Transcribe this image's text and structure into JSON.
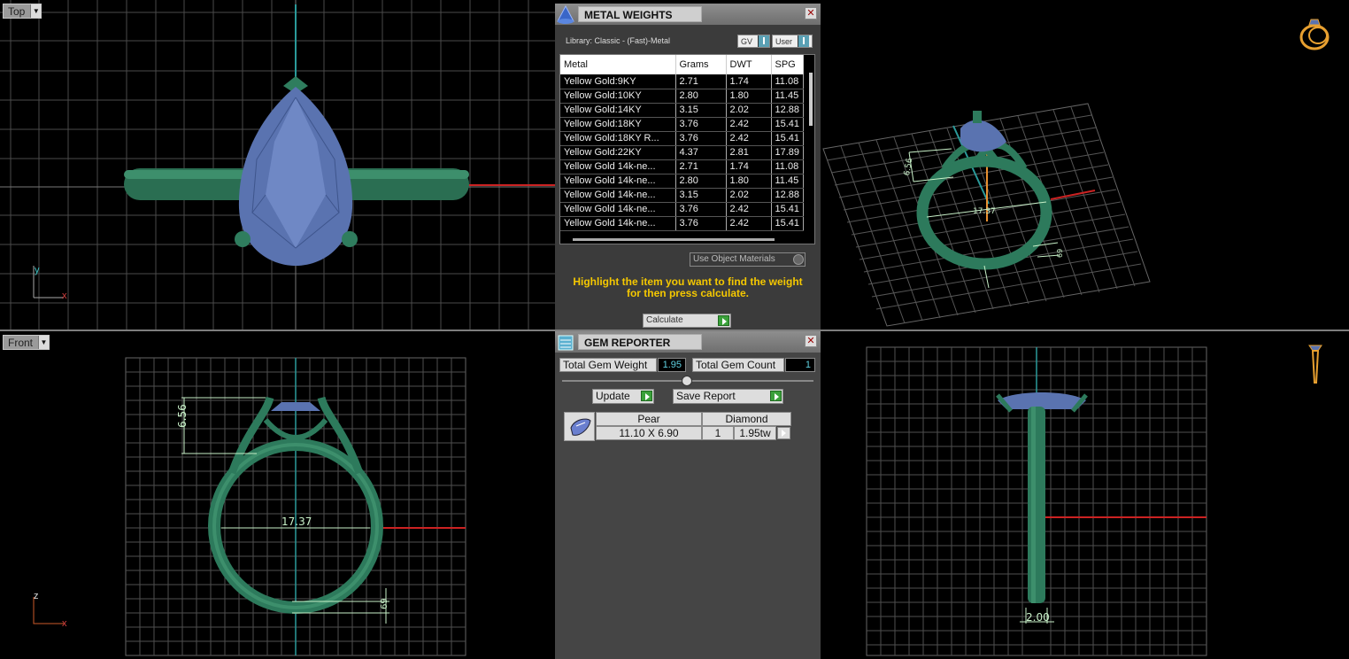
{
  "viewports": {
    "top": {
      "label": "Top"
    },
    "front": {
      "label": "Front"
    },
    "front_dims": {
      "height": "6.56",
      "width": "17.37",
      "band": "69"
    },
    "persp_dims": {
      "height": "6.56",
      "width": "17.37",
      "band": "69"
    },
    "right_dims": {
      "band_width": "2.00"
    }
  },
  "metal_weights": {
    "title": "METAL WEIGHTS",
    "library": "Library: Classic - (Fast)-Metal",
    "toggle_gv": "GV",
    "toggle_user": "User",
    "columns": [
      "Metal",
      "Grams",
      "DWT",
      "SPG"
    ],
    "rows": [
      [
        "Yellow Gold:9KY",
        "2.71",
        "1.74",
        "11.08"
      ],
      [
        "Yellow Gold:10KY",
        "2.80",
        "1.80",
        "11.45"
      ],
      [
        "Yellow Gold:14KY",
        "3.15",
        "2.02",
        "12.88"
      ],
      [
        "Yellow Gold:18KY",
        "3.76",
        "2.42",
        "15.41"
      ],
      [
        "Yellow Gold:18KY R...",
        "3.76",
        "2.42",
        "15.41"
      ],
      [
        "Yellow Gold:22KY",
        "4.37",
        "2.81",
        "17.89"
      ],
      [
        "Yellow Gold 14k-ne...",
        "2.71",
        "1.74",
        "11.08"
      ],
      [
        "Yellow Gold 14k-ne...",
        "2.80",
        "1.80",
        "11.45"
      ],
      [
        "Yellow Gold 14k-ne...",
        "3.15",
        "2.02",
        "12.88"
      ],
      [
        "Yellow Gold 14k-ne...",
        "3.76",
        "2.42",
        "15.41"
      ],
      [
        "Yellow Gold 14k-ne...",
        "3.76",
        "2.42",
        "15.41"
      ]
    ],
    "use_object_materials": "Use Object Materials",
    "hint_line1": "Highlight the item you want to find the weight",
    "hint_line2": "for then press calculate.",
    "calculate": "Calculate"
  },
  "gem_reporter": {
    "title": "GEM REPORTER",
    "total_weight_label": "Total Gem Weight",
    "total_weight_value": "1.95",
    "total_count_label": "Total Gem Count",
    "total_count_value": "1",
    "update": "Update",
    "save_report": "Save Report",
    "gem": {
      "shape": "Pear",
      "size": "11.10 X 6.90",
      "type": "Diamond",
      "count": "1",
      "weight": "1.95tw"
    }
  },
  "colors": {
    "band": "#2d7a5c",
    "stone": "#5a73b0",
    "dimension": "#c8f0c8",
    "accent": "#f5c800"
  }
}
